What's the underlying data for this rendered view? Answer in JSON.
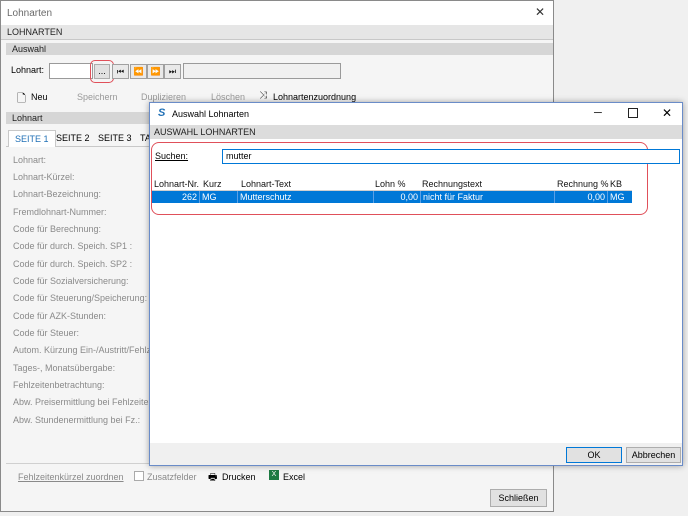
{
  "main_window": {
    "title": "Lohnarten",
    "header": "LOHNARTEN",
    "section_auswahl": "Auswahl",
    "lohnart_label": "Lohnart:",
    "lookup_button": "...",
    "toolbar": {
      "neu": "Neu",
      "speichern": "Speichern",
      "duplizieren": "Duplizieren",
      "loeschen": "Löschen",
      "zuordnung": "Lohnartenzuordnung"
    },
    "section_lohnart": "Lohnart",
    "tabs": [
      "SEITE 1",
      "SEITE 2",
      "SEITE 3",
      "TA"
    ],
    "fields": [
      "Lohnart:",
      "Lohnart-Kürzel:",
      "Lohnart-Bezeichnung:",
      "Fremdlohnart-Nummer:",
      "Code für Berechnung:",
      "Code für durch. Speich. SP1 :",
      "Code für durch. Speich. SP2 :",
      "Code für Sozialversicherung:",
      "Code für Steuerung/Speicherung:",
      "Code für AZK-Stunden:",
      "Code für Steuer:",
      "Autom. Kürzung Ein-/Austritt/Fehlz",
      "Tages-, Monatsübergabe:",
      "Fehlzeitenbetrachtung:",
      "Abw. Preisermittlung bei Fehlzeiten",
      "Abw. Stundenermittlung bei Fz.:"
    ],
    "bottom": {
      "fehlzeiten": "Fehlzeitenkürzel zuordnen",
      "zusatzfelder": "Zusatzfelder",
      "drucken": "Drucken",
      "excel": "Excel",
      "schliessen": "Schließen"
    }
  },
  "dialog": {
    "title": "Auswahl Lohnarten",
    "header": "AUSWAHL LOHNARTEN",
    "search_label": "Suchen:",
    "search_value": "mutter",
    "columns": [
      "Lohnart-Nr.",
      "Kurz",
      "Lohnart-Text",
      "Lohn %",
      "Rechnungstext",
      "Rechnung %",
      "KB"
    ],
    "rows": [
      {
        "nr": "262",
        "kurz": "MG",
        "text": "Mutterschutz",
        "lohn": "0,00",
        "rechnungstext": "nicht für Faktur",
        "rechnung": "0,00",
        "kb": "MG"
      }
    ],
    "ok": "OK",
    "abbrechen": "Abbrechen"
  },
  "colors": {
    "selection": "#0078d7",
    "highlight_frame": "#e0505a",
    "tab_active": "#1f6fb5"
  }
}
